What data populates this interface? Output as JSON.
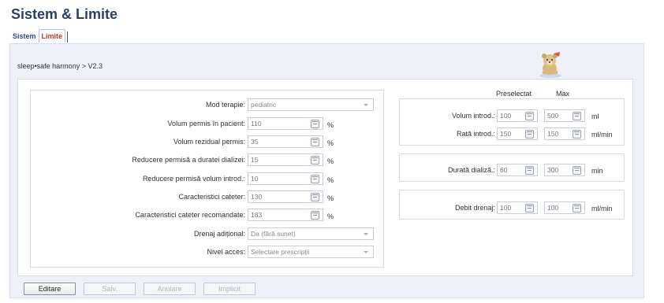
{
  "page": {
    "title": "Sistem & Limite"
  },
  "tabs": [
    {
      "label": "Sistem"
    },
    {
      "label": "Limite"
    }
  ],
  "breadcrumb": "sleep•safe harmony > V2.3",
  "mascot_icon": "bear-mascot-icon",
  "left_form": {
    "mod_terapie": {
      "label": "Mod terapie:",
      "value": "pediatric"
    },
    "volum_permis": {
      "label": "Volum permis în pacient:",
      "value": "110",
      "unit": "%"
    },
    "volum_rezidual": {
      "label": "Volum rezidual permis:",
      "value": "35",
      "unit": "%"
    },
    "reducere_durata": {
      "label": "Reducere permisă a duratei dializei:",
      "value": "15",
      "unit": "%"
    },
    "reducere_volum": {
      "label": "Reducere permisă volum introd.:",
      "value": "10",
      "unit": "%"
    },
    "caracteristici_cateter": {
      "label": "Caracteristici cateter:",
      "value": "130",
      "unit": "%"
    },
    "caracteristici_recomandate": {
      "label": "Caracteristici cateter recomandate:",
      "value": "183",
      "unit": "%"
    },
    "drenaj_aditional": {
      "label": "Drenaj adițional:",
      "value": "Da (fără sunet)"
    },
    "nivel_acces": {
      "label": "Nivel acces:",
      "value": "Selectare prescripții"
    }
  },
  "right_form": {
    "header_preselectat": "Preselectat",
    "header_max": "Max",
    "volum_introd": {
      "label": "Volum introd.:",
      "preselectat": "100",
      "max": "500",
      "unit": "ml"
    },
    "rata_introd": {
      "label": "Rată introd.:",
      "preselectat": "150",
      "max": "150",
      "unit": "ml/min"
    },
    "durata_dializa": {
      "label": "Durată dializă.:",
      "preselectat": "60",
      "max": "300",
      "unit": "min"
    },
    "debit_drenaj": {
      "label": "Debit drenaj:",
      "preselectat": "100",
      "max": "100",
      "unit": "ml/min"
    }
  },
  "buttons": {
    "editare": "Editare",
    "salv": "Salv.",
    "anulare": "Anulare",
    "implicit": "Implicit"
  },
  "colors": {
    "title": "#2c3e66",
    "active_tab": "#c0392b",
    "panel_bg": "#eef2f8"
  }
}
